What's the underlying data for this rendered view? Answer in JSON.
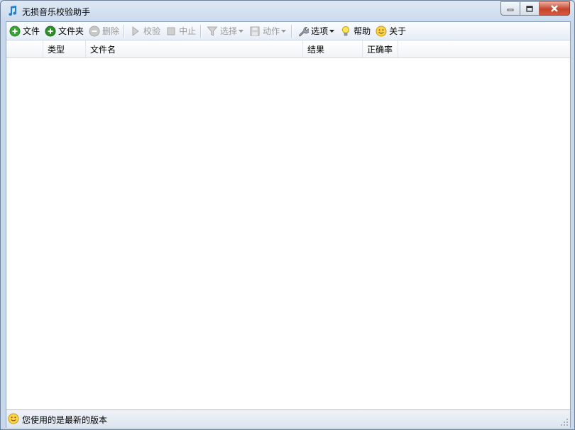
{
  "window": {
    "title": "无损音乐校验助手"
  },
  "toolbar": {
    "file": "文件",
    "folder": "文件夹",
    "delete": "删除",
    "verify": "校验",
    "stop": "中止",
    "select": "选择",
    "action": "动作",
    "options": "选项",
    "help": "帮助",
    "about": "关于"
  },
  "table": {
    "columns": [
      "",
      "类型",
      "文件名",
      "结果",
      "正确率"
    ]
  },
  "status": {
    "text": "您使用的是最新的版本"
  },
  "colors": {
    "accent_green": "#3aa436",
    "disabled_text": "#9a9a9a",
    "titlebar": "#c9d9ec",
    "close_button": "#c7442c"
  }
}
